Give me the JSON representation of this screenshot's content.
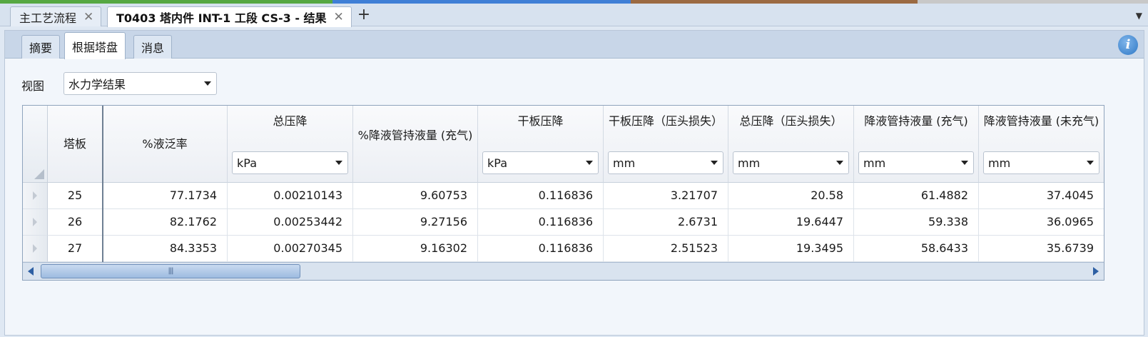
{
  "colors": {
    "strip": [
      "#56a843",
      "#3f7fd6",
      "#9b6a42",
      "#c8c8c8"
    ]
  },
  "doc_tabs": [
    {
      "label": "主工艺流程",
      "active": false
    },
    {
      "label": "T0403 塔内件 INT-1 工段 CS-3 - 结果",
      "active": true
    }
  ],
  "sub_tabs": [
    {
      "label": "摘要"
    },
    {
      "label": "根据塔盘"
    },
    {
      "label": "消息"
    }
  ],
  "view": {
    "label": "视图",
    "value": "水力学结果"
  },
  "grid": {
    "columns": [
      {
        "title": "塔板",
        "unit": ""
      },
      {
        "title": "%液泛率",
        "unit": ""
      },
      {
        "title": "总压降",
        "unit": "kPa"
      },
      {
        "title": "%降液管持液量 (充气)",
        "unit": ""
      },
      {
        "title": "干板压降",
        "unit": "kPa"
      },
      {
        "title": "干板压降（压头损失）",
        "unit": "mm"
      },
      {
        "title": "总压降（压头损失）",
        "unit": "mm"
      },
      {
        "title": "降液管持液量 (充气)",
        "unit": "mm"
      },
      {
        "title": "降液管持液量 (未充气)",
        "unit": "mm"
      }
    ],
    "rows": [
      [
        "25",
        "77.1734",
        "0.00210143",
        "9.60753",
        "0.116836",
        "3.21707",
        "20.58",
        "61.4882",
        "37.4045"
      ],
      [
        "26",
        "82.1762",
        "0.00253442",
        "9.27156",
        "0.116836",
        "2.6731",
        "19.6447",
        "59.338",
        "36.0965"
      ],
      [
        "27",
        "84.3353",
        "0.00270345",
        "9.16302",
        "0.116836",
        "2.51523",
        "19.3495",
        "58.6433",
        "35.6739"
      ]
    ],
    "scroll_grip": "|||"
  }
}
